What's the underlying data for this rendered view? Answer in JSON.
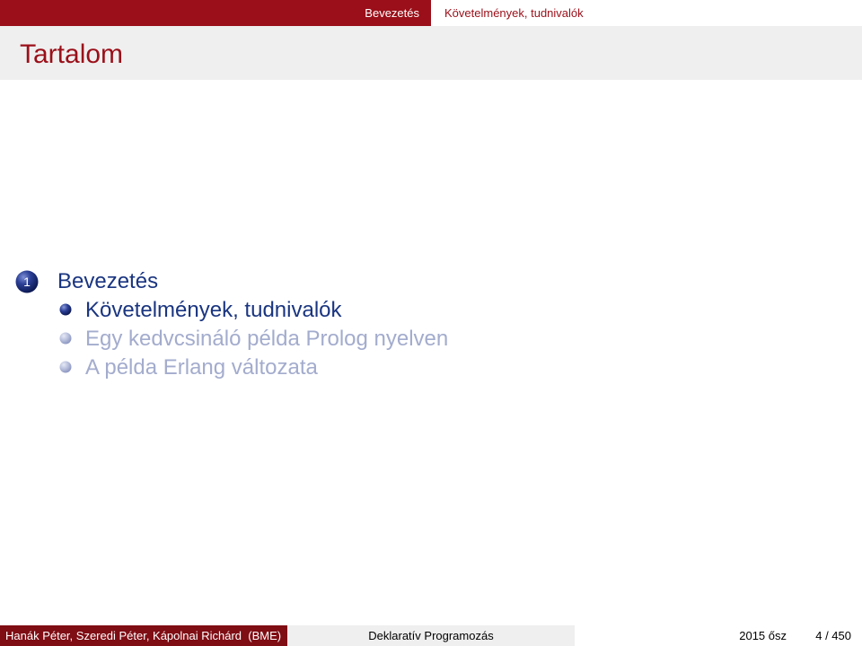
{
  "nav": {
    "section": "Bevezetés",
    "subsection": "Követelmények, tudnivalók"
  },
  "frame": {
    "title": "Tartalom"
  },
  "toc": {
    "section_number": "1",
    "section_title": "Bevezetés",
    "subsections": [
      {
        "label": "Követelmények, tudnivalók",
        "state": "active"
      },
      {
        "label": "Egy kedvcsináló példa Prolog nyelven",
        "state": "dim"
      },
      {
        "label": "A példa Erlang változata",
        "state": "dim"
      }
    ]
  },
  "footer": {
    "authors": "Hanák Péter, Szeredi Péter, Kápolnai Richárd",
    "institution": "(BME)",
    "course": "Deklaratív Programozás",
    "date": "2015 ősz",
    "page": "4 / 450"
  },
  "colors": {
    "theme_red": "#9a0f19",
    "footer_red": "#7f0d14",
    "structure_blue": "#1a3580",
    "dim_blue": "#a3accd",
    "title_bg": "#efefef"
  }
}
